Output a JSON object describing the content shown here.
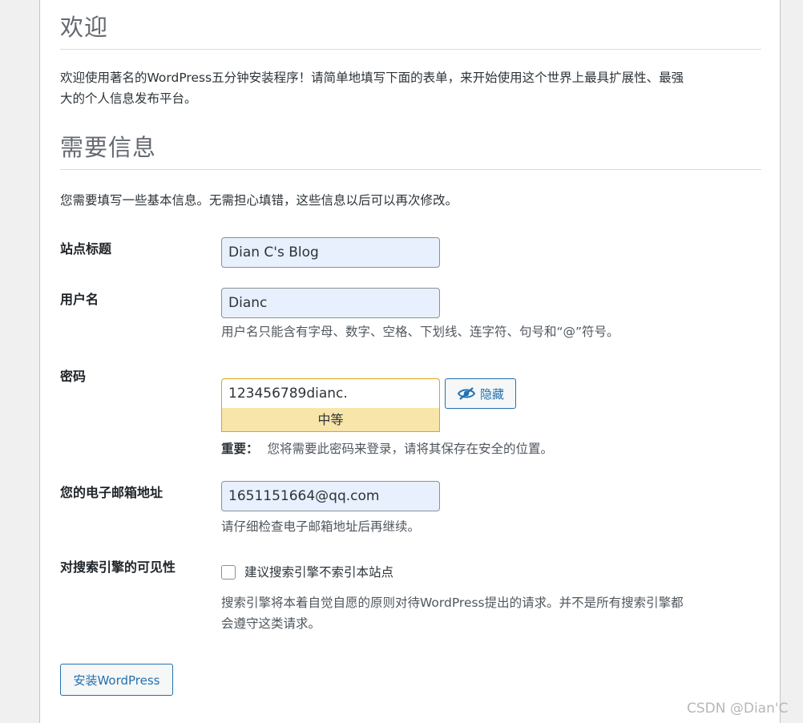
{
  "welcome": {
    "heading": "欢迎",
    "intro_line1": "欢迎使用著名的WordPress五分钟安装程序！请简单地填写下面的表单，来开始使用这个世界上最具扩展性、最强",
    "intro_line2": "大的个人信息发布平台。"
  },
  "required": {
    "heading": "需要信息",
    "intro": "您需要填写一些基本信息。无需担心填错，这些信息以后可以再次修改。"
  },
  "form": {
    "site_title": {
      "label": "站点标题",
      "value": "Dian C's Blog"
    },
    "username": {
      "label": "用户名",
      "value": "Dianc",
      "hint": "用户名只能含有字母、数字、空格、下划线、连字符、句号和“@”符号。"
    },
    "password": {
      "label": "密码",
      "value": "123456789dianc.",
      "strength": "中等",
      "hide_label": "隐藏",
      "important_label": "重要：",
      "important_text": "您将需要此密码来登录，请将其保存在安全的位置。"
    },
    "email": {
      "label": "您的电子邮箱地址",
      "value": "1651151664@qq.com",
      "hint": "请仔细检查电子邮箱地址后再继续。"
    },
    "visibility": {
      "label": "对搜索引擎的可见性",
      "checkbox_label": "建议搜索引擎不索引本站点",
      "checked": false,
      "note_line1": "搜索引擎将本着自觉自愿的原则对待WordPress提出的请求。并不是所有搜索引擎都",
      "note_line2": "会遵守这类请求。"
    }
  },
  "install_button": "安装WordPress",
  "watermark": "CSDN @Dian'C",
  "colors": {
    "accent": "#2271b1",
    "strength_bg": "#f8e5a9",
    "strength_border": "#dba617",
    "autofill_bg": "#e8f0fe"
  }
}
